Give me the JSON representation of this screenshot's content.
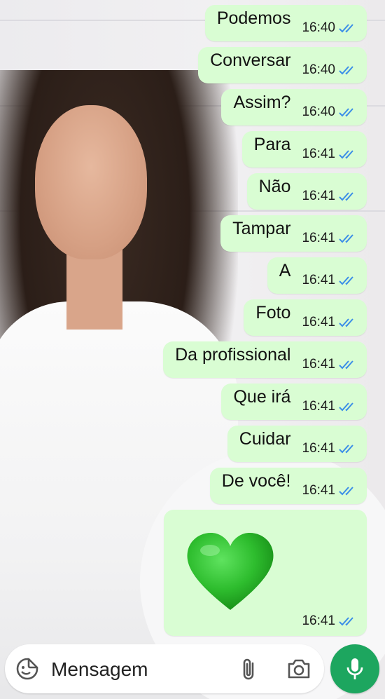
{
  "messages": [
    {
      "text": "Podemos",
      "time": "16:40"
    },
    {
      "text": "Conversar",
      "time": "16:40"
    },
    {
      "text": "Assim?",
      "time": "16:40"
    },
    {
      "text": "Para",
      "time": "16:41"
    },
    {
      "text": "Não",
      "time": "16:41"
    },
    {
      "text": "Tampar",
      "time": "16:41"
    },
    {
      "text": "A",
      "time": "16:41"
    },
    {
      "text": "Foto",
      "time": "16:41"
    },
    {
      "text": "Da profissional",
      "time": "16:41"
    },
    {
      "text": "Que irá",
      "time": "16:41"
    },
    {
      "text": "Cuidar",
      "time": "16:41"
    },
    {
      "text": "De você!",
      "time": "16:41"
    }
  ],
  "emoji_message": {
    "emoji": "green-heart",
    "time": "16:41"
  },
  "composer": {
    "placeholder": "Mensagem"
  },
  "icons": {
    "sticker": "sticker-icon",
    "attach": "paperclip-icon",
    "camera": "camera-icon",
    "mic": "microphone-icon",
    "read_receipt": "double-check-icon"
  },
  "colors": {
    "outgoing_bubble": "#d9fdd3",
    "read_ticks": "#3b8ee8",
    "mic_button": "#1da65f",
    "heart": "#2ebd2e"
  }
}
